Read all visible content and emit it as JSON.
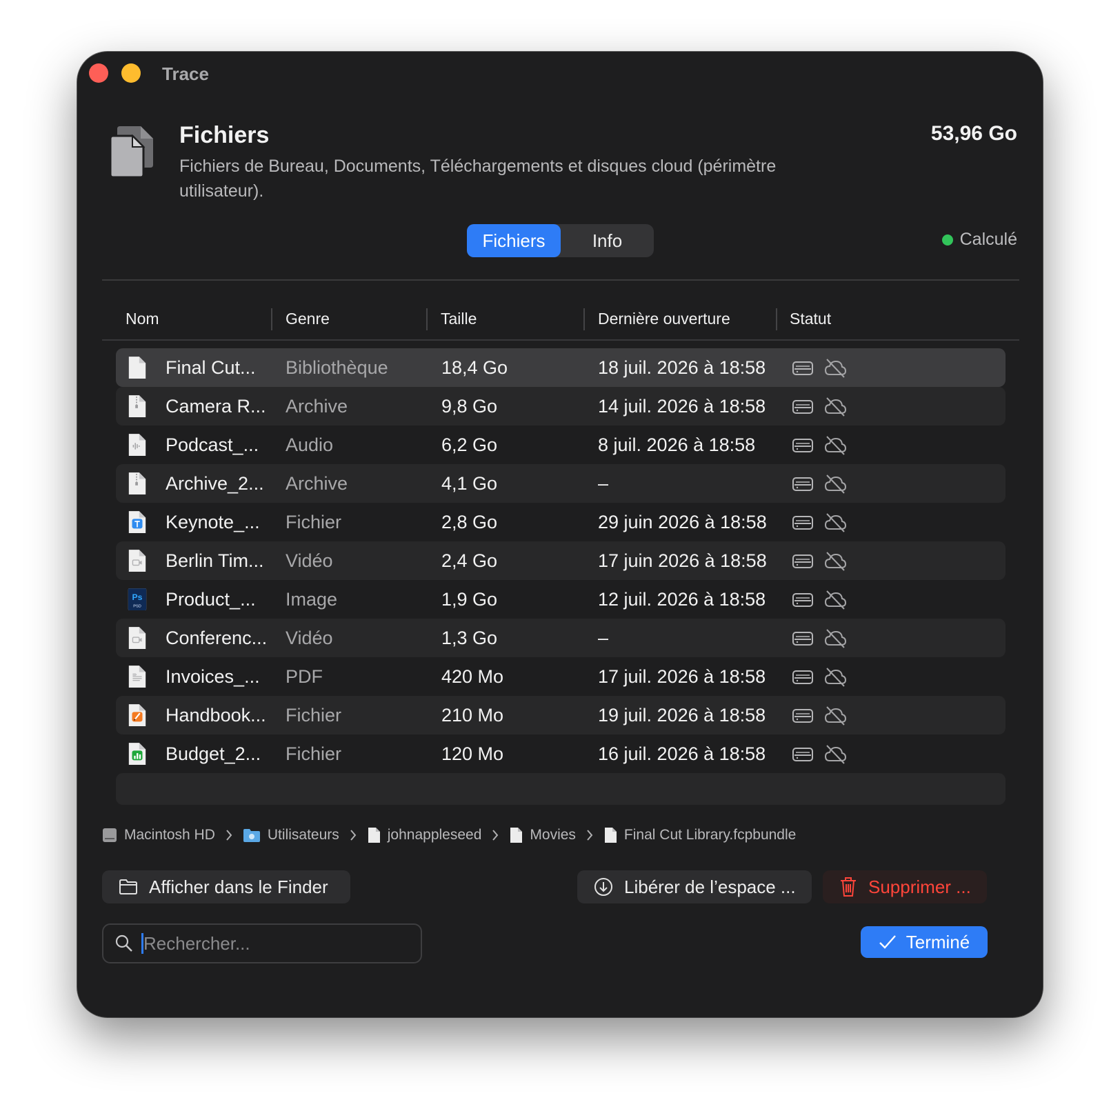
{
  "window": {
    "title": "Trace"
  },
  "header": {
    "title": "Fichiers",
    "total_size": "53,96 Go",
    "description": "Fichiers de Bureau, Documents, Téléchargements et disques cloud (périmètre utilisateur)."
  },
  "tabs": [
    {
      "label": "Fichiers",
      "active": true
    },
    {
      "label": "Info",
      "active": false
    }
  ],
  "status": {
    "label": "Calculé",
    "color": "#32c45a"
  },
  "table": {
    "columns": [
      "Nom",
      "Genre",
      "Taille",
      "Dernière ouverture",
      "Statut"
    ],
    "rows": [
      {
        "name": "Final Cut...",
        "genre": "Bibliothèque",
        "size": "18,4 Go",
        "last_opened": "18 juil. 2026 à 18:58",
        "icon": "document-icon"
      },
      {
        "name": "Camera R...",
        "genre": "Archive",
        "size": "9,8 Go",
        "last_opened": "14 juil. 2026 à 18:58",
        "icon": "archive-icon"
      },
      {
        "name": "Podcast_...",
        "genre": "Audio",
        "size": "6,2 Go",
        "last_opened": "8 juil. 2026 à 18:58",
        "icon": "audio-file-icon"
      },
      {
        "name": "Archive_2...",
        "genre": "Archive",
        "size": "4,1 Go",
        "last_opened": "–",
        "icon": "archive-icon"
      },
      {
        "name": "Keynote_...",
        "genre": "Fichier",
        "size": "2,8 Go",
        "last_opened": "29 juin 2026 à 18:58",
        "icon": "keynote-icon"
      },
      {
        "name": "Berlin Tim...",
        "genre": "Vidéo",
        "size": "2,4 Go",
        "last_opened": "17 juin 2026 à 18:58",
        "icon": "video-file-icon"
      },
      {
        "name": "Product_...",
        "genre": "Image",
        "size": "1,9 Go",
        "last_opened": "12 juil. 2026 à 18:58",
        "icon": "psd-icon"
      },
      {
        "name": "Conferenc...",
        "genre": "Vidéo",
        "size": "1,3 Go",
        "last_opened": "–",
        "icon": "video-file-icon"
      },
      {
        "name": "Invoices_...",
        "genre": "PDF",
        "size": "420 Mo",
        "last_opened": "17 juil. 2026 à 18:58",
        "icon": "pdf-icon"
      },
      {
        "name": "Handbook...",
        "genre": "Fichier",
        "size": "210 Mo",
        "last_opened": "19 juil. 2026 à 18:58",
        "icon": "pages-icon"
      },
      {
        "name": "Budget_2...",
        "genre": "Fichier",
        "size": "120 Mo",
        "last_opened": "16 juil. 2026 à 18:58",
        "icon": "numbers-icon"
      }
    ]
  },
  "breadcrumb": [
    "Macintosh HD",
    "Utilisateurs",
    "johnappleseed",
    "Movies",
    "Final Cut Library.fcpbundle"
  ],
  "actions": {
    "show_in_finder": "Afficher dans le Finder",
    "free_space": "Libérer de l’espace ...",
    "delete": "Supprimer ..."
  },
  "search": {
    "placeholder": "Rechercher...",
    "value": ""
  },
  "done_button": "Terminé",
  "colors": {
    "accent": "#2e7cf6",
    "danger": "#ff453a",
    "background": "#1e1e1f"
  }
}
